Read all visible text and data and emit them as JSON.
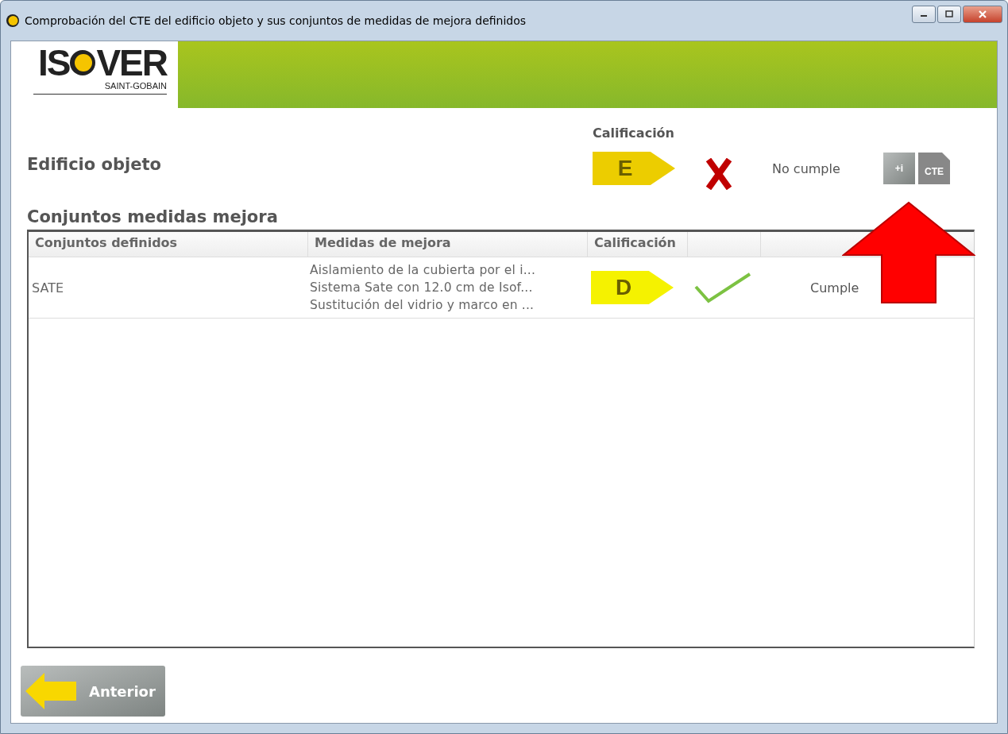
{
  "window": {
    "title": "Comprobación del CTE del edificio objeto y sus conjuntos de medidas de mejora definidos"
  },
  "logo": {
    "left": "IS",
    "right": "VER",
    "sub": "SAINT-GOBAIN"
  },
  "building": {
    "heading": "Calificación",
    "label": "Edificio objeto",
    "rating": {
      "letter": "E",
      "color": "#eccd00"
    },
    "compliant": false,
    "status": "No cumple",
    "buttons": [
      {
        "kind": "info",
        "label": "+i"
      },
      {
        "kind": "cte",
        "label": "CTE"
      }
    ]
  },
  "section_title": "Conjuntos medidas mejora",
  "table": {
    "columns": [
      "Conjuntos definidos",
      "Medidas de mejora",
      "Calificación"
    ],
    "rows": [
      {
        "name": "SATE",
        "measures": [
          "Aislamiento de la cubierta por el i...",
          "Sistema Sate con 12.0 cm de Isof...",
          "Sustitución del vidrio y marco en ..."
        ],
        "rating": {
          "letter": "D",
          "color": "#f5f200"
        },
        "compliant": true,
        "status": "Cumple"
      }
    ]
  },
  "footer": {
    "back_button": "Anterior"
  }
}
